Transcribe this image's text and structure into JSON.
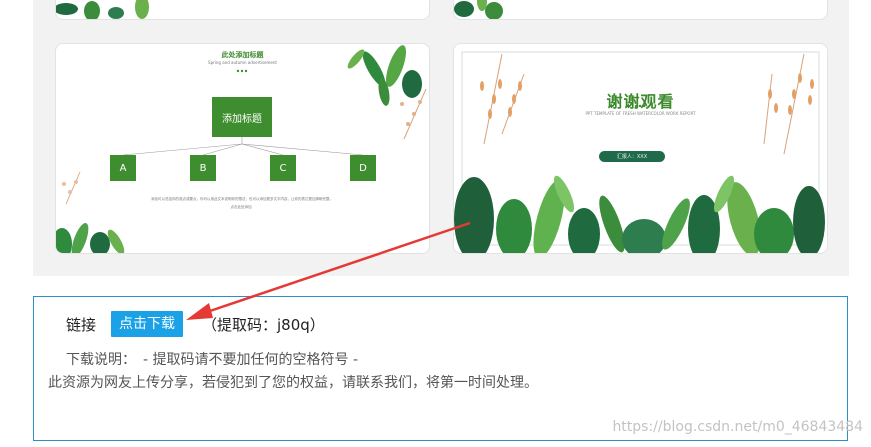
{
  "slides": {
    "diagram": {
      "title": "此处添加标题",
      "subtitle": "Spring and autumn advertisement",
      "main_box": "添加标题",
      "nodes": [
        "A",
        "B",
        "C",
        "D"
      ],
      "body_text": "添加可以总结你的观点或要点，你可以用此文本说明你的想法，也可以添加更多文字内容，让你的表达更加清晰完整。",
      "body_text_2": "点击此处添加"
    },
    "thanks": {
      "title": "谢谢观看",
      "subtitle": "PPT TEMPLATE OF FRESH WATERCOLOR WORK REPORT",
      "pill": "汇报人：XXX"
    }
  },
  "download": {
    "link_label": "链接",
    "button_label": "点击下载",
    "code_text": "（提取码：j80q）",
    "desc_line1": "下载说明：　- 提取码请不要加任何的空格符号 -",
    "desc_line2": "此资源为网友上传分享，若侵犯到了您的权益，请联系我们，将第一时间处理。"
  },
  "watermark": "https://blog.csdn.net/m0_46843484",
  "colors": {
    "accent": "#1aa1e6",
    "border": "#2b8fc9",
    "arrow": "#e53935",
    "green": "#3e8e2f"
  }
}
